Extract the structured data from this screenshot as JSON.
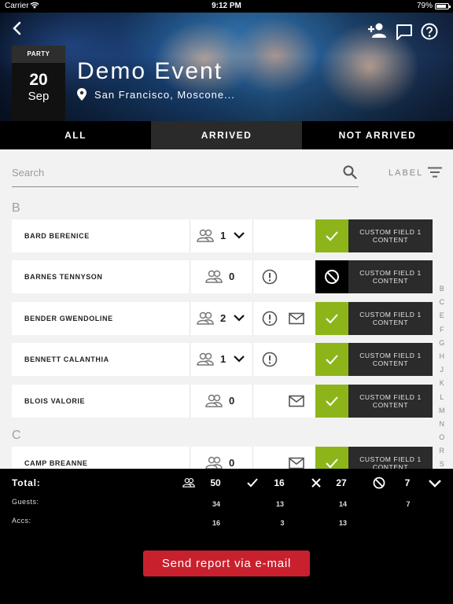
{
  "status_bar": {
    "carrier": "Carrier",
    "time": "9:12 PM",
    "battery": "79%"
  },
  "header": {
    "category": "PARTY",
    "day": "20",
    "month": "Sep",
    "title": "Demo Event",
    "location": "San Francisco, Moscone..."
  },
  "tabs": [
    {
      "label": "ALL",
      "active": true
    },
    {
      "label": "ARRIVED",
      "active": false
    },
    {
      "label": "NOT ARRIVED",
      "active": false
    }
  ],
  "search": {
    "placeholder": "Search",
    "label_button": "LABEL"
  },
  "sections": [
    {
      "letter": "B",
      "rows": [
        {
          "name": "BARD BERENICE",
          "guests": "1",
          "expandable": true,
          "alert": false,
          "mail": false,
          "status": "arrived",
          "custom": [
            "CUSTOM FIELD 1",
            "CONTENT"
          ]
        },
        {
          "name": "BARNES TENNYSON",
          "guests": "0",
          "expandable": false,
          "alert": true,
          "mail": false,
          "status": "blocked",
          "custom": [
            "CUSTOM FIELD 1",
            "CONTENT"
          ]
        },
        {
          "name": "BENDER GWENDOLINE",
          "guests": "2",
          "expandable": true,
          "alert": true,
          "mail": true,
          "status": "arrived",
          "custom": [
            "CUSTOM FIELD 1",
            "CONTENT"
          ]
        },
        {
          "name": "BENNETT CALANTHIA",
          "guests": "1",
          "expandable": true,
          "alert": true,
          "mail": false,
          "status": "arrived",
          "custom": [
            "CUSTOM FIELD 1",
            "CONTENT"
          ]
        },
        {
          "name": "BLOIS VALORIE",
          "guests": "0",
          "expandable": false,
          "alert": false,
          "mail": true,
          "status": "arrived",
          "custom": [
            "CUSTOM FIELD 1",
            "CONTENT"
          ]
        }
      ]
    },
    {
      "letter": "C",
      "rows": [
        {
          "name": "CAMP BREANNE",
          "guests": "0",
          "expandable": false,
          "alert": false,
          "mail": true,
          "status": "arrived",
          "custom": [
            "CUSTOM FIELD 1",
            "CONTENT"
          ]
        }
      ]
    }
  ],
  "alphabet": [
    "B",
    "C",
    "E",
    "F",
    "G",
    "H",
    "J",
    "K",
    "L",
    "M",
    "N",
    "O",
    "R",
    "S"
  ],
  "footer": {
    "total_label": "Total:",
    "guests_label": "Guests:",
    "accs_label": "Accs:",
    "columns": [
      {
        "icon": "people-icon",
        "total": "50",
        "guests": "34",
        "accs": "16"
      },
      {
        "icon": "check-icon",
        "total": "16",
        "guests": "13",
        "accs": "3"
      },
      {
        "icon": "x-icon",
        "total": "27",
        "guests": "14",
        "accs": "13"
      },
      {
        "icon": "blocked-icon",
        "total": "7",
        "guests": "7",
        "accs": ""
      }
    ],
    "send_button": "Send report via e-mail"
  },
  "colors": {
    "arrived": "#8db51a",
    "blocked": "#000000",
    "send_button": "#c9202e",
    "custom_field_bg": "#2b2b2b"
  }
}
